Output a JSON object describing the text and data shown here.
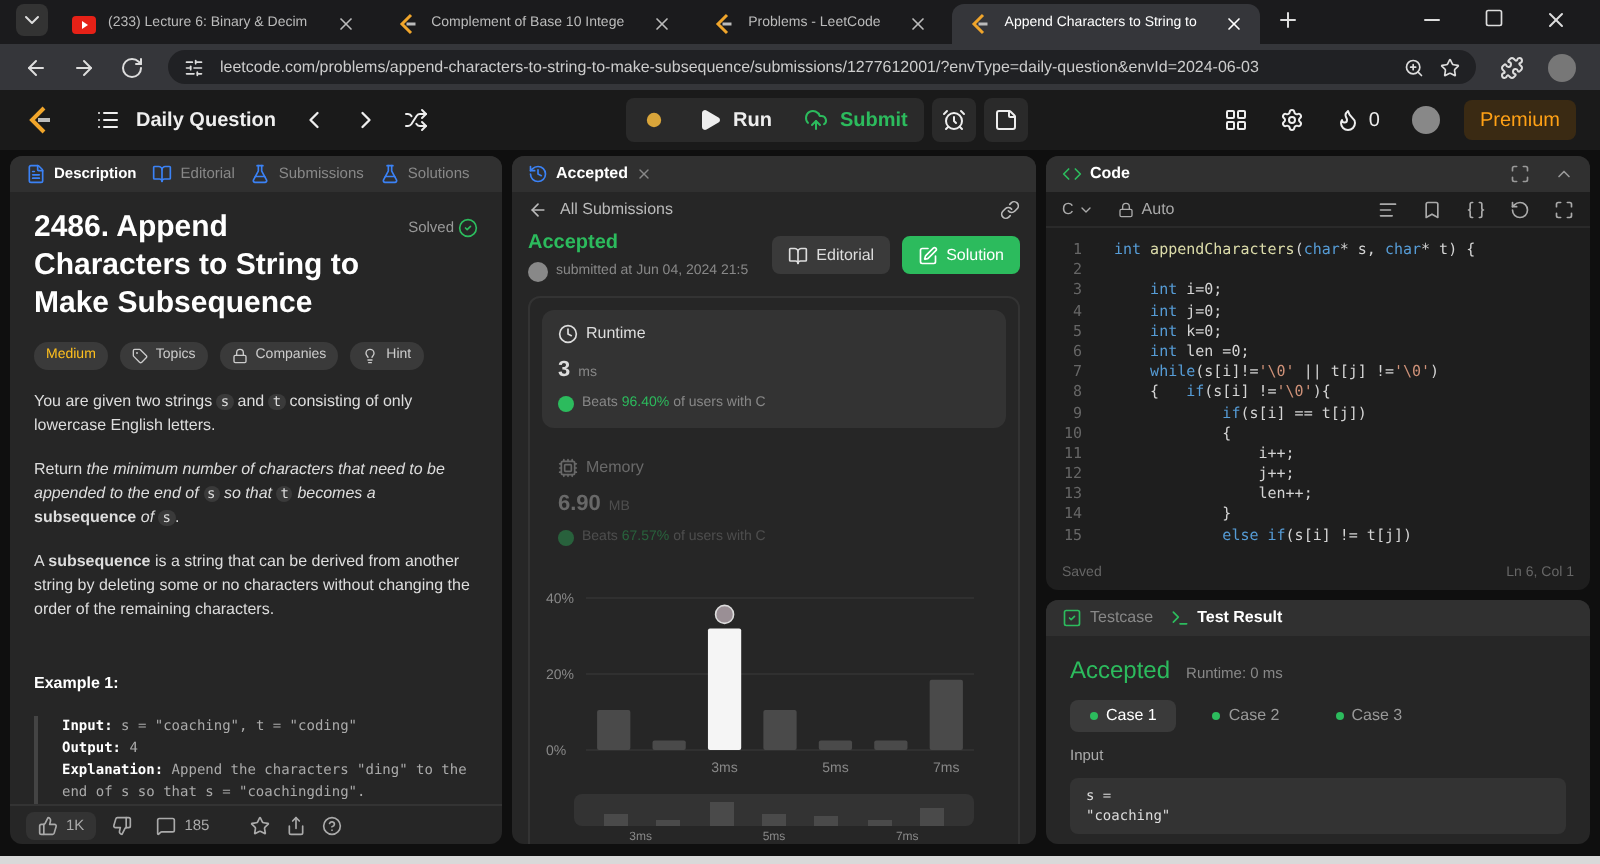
{
  "browser": {
    "tabs": [
      {
        "title": "(233) Lecture 6: Binary & Decim",
        "kind": "video",
        "selected": false
      },
      {
        "title": "Complement of Base 10 Intege",
        "kind": "leetcode",
        "selected": false
      },
      {
        "title": "Problems - LeetCode",
        "kind": "leetcode",
        "selected": false
      },
      {
        "title": "Append Characters to String to",
        "kind": "leetcode",
        "selected": true
      }
    ],
    "url": "leetcode.com/problems/append-characters-to-string-to-make-subsequence/submissions/1277612001/?envType=daily-question&envId=2024-06-03"
  },
  "navbar": {
    "title": "Daily Question",
    "run": "Run",
    "submit": "Submit",
    "streak": "0",
    "premium": "Premium"
  },
  "description_panel": {
    "tabs": [
      {
        "label": "Description",
        "selected": true
      },
      {
        "label": "Editorial",
        "selected": false
      },
      {
        "label": "Submissions",
        "selected": false
      },
      {
        "label": "Solutions",
        "selected": false
      }
    ],
    "title": "2486. Append Characters to String to Make Subsequence",
    "status": "Solved",
    "tags": [
      {
        "label": "Medium",
        "kind": "difficulty"
      },
      {
        "label": "Topics",
        "kind": "topics"
      },
      {
        "label": "Companies",
        "kind": "companies"
      },
      {
        "label": "Hint",
        "kind": "hint"
      }
    ],
    "paragraphs": [
      [
        {
          "kind": "text",
          "t": "You are given two strings "
        },
        {
          "kind": "code",
          "t": "s"
        },
        {
          "kind": "text",
          "t": " and "
        },
        {
          "kind": "code",
          "t": "t"
        },
        {
          "kind": "text",
          "t": " consisting of only lowercase English letters."
        }
      ],
      [
        {
          "kind": "text",
          "t": "Return *the minimum number of characters that need to be appended to the end of* "
        },
        {
          "kind": "code",
          "t": "s"
        },
        {
          "kind": "text",
          "t": " *so that* "
        },
        {
          "kind": "code",
          "t": "t"
        },
        {
          "kind": "text",
          "t": " *becomes a* **subsequence** *of* "
        },
        {
          "kind": "code",
          "t": "s"
        },
        {
          "kind": "text",
          "t": "."
        }
      ],
      [
        {
          "kind": "text",
          "t": "A **subsequence** is a string that can be derived from another string by deleting some or no characters without changing the order of the remaining characters."
        }
      ]
    ],
    "example_title": "Example 1:",
    "example": [
      {
        "label": "Input:",
        "value": "s = \"coaching\", t = \"coding\""
      },
      {
        "label": "Output:",
        "value": "4"
      },
      {
        "label": "Explanation:",
        "value": "Append the characters \"ding\" to the end of s so that s = \"coachingding\"."
      }
    ],
    "likes": "1K",
    "comments": "185"
  },
  "submission_panel": {
    "tab": "Accepted",
    "back": "All Submissions",
    "verdict": "Accepted",
    "submitted": "submitted at Jun 04, 2024 21:5",
    "editorial": "Editorial",
    "solution": "Solution",
    "metrics": [
      {
        "kind": "runtime",
        "label": "Runtime",
        "value": "3",
        "unit": "ms",
        "beats_prefix": "Beats",
        "beats": "96.40%",
        "beats_suffix": "of users with C",
        "selected": true
      },
      {
        "kind": "memory",
        "label": "Memory",
        "value": "6.90",
        "unit": "MB",
        "beats_prefix": "Beats",
        "beats": "67.57%",
        "beats_suffix": "of users with C",
        "selected": false
      }
    ],
    "chart_data": {
      "type": "bar",
      "x": [
        1,
        2,
        3,
        4,
        5,
        6,
        7
      ],
      "xlim": [
        0.5,
        7.5
      ],
      "xticks": [
        {
          "value": 3,
          "label": "3ms"
        },
        {
          "value": 5,
          "label": "5ms"
        },
        {
          "value": 7,
          "label": "7ms"
        }
      ],
      "ylim": [
        0,
        40
      ],
      "yticks": [
        {
          "value": 0,
          "label": "0%"
        },
        {
          "value": 20,
          "label": "20%"
        },
        {
          "value": 40,
          "label": "40%"
        }
      ],
      "series": [
        {
          "color": "#4a4a4a",
          "values": [
            10.5,
            2.5,
            null,
            10.5,
            2.5,
            2.5,
            18.5
          ]
        },
        {
          "color": "#f5f5f5",
          "values": [
            null,
            null,
            32,
            null,
            null,
            null,
            null
          ]
        }
      ]
    },
    "brush_labels": [
      "3ms",
      "5ms",
      "7ms"
    ]
  },
  "code_panel": {
    "title": "Code",
    "language": "C",
    "mode": "Auto",
    "lines": [
      {
        "n": "1",
        "tokens": [
          {
            "kind": "kw",
            "t": "int"
          },
          {
            "kind": "fn",
            "t": " appendCharacters"
          },
          {
            "kind": "p",
            "t": "("
          },
          {
            "kind": "kw",
            "t": "char"
          },
          {
            "kind": "p",
            "t": "* s, "
          },
          {
            "kind": "kw",
            "t": "char"
          },
          {
            "kind": "p",
            "t": "* t) {"
          }
        ]
      },
      {
        "n": "2"
      },
      {
        "n": "3",
        "tokens": [
          {
            "kind": "kw",
            "t": "    int"
          },
          {
            "kind": "p",
            "t": " i=0;"
          }
        ]
      },
      {
        "n": "4",
        "tokens": [
          {
            "kind": "kw",
            "t": "    int"
          },
          {
            "kind": "p",
            "t": " j=0;"
          }
        ]
      },
      {
        "n": "5",
        "tokens": [
          {
            "kind": "kw",
            "t": "    int"
          },
          {
            "kind": "p",
            "t": " k=0;"
          }
        ]
      },
      {
        "n": "6",
        "tokens": [
          {
            "kind": "kw",
            "t": "    int"
          },
          {
            "kind": "p",
            "t": " len =0;"
          }
        ]
      },
      {
        "n": "7",
        "tokens": [
          {
            "kind": "kw",
            "t": "    while"
          },
          {
            "kind": "p",
            "t": "(s[i]!="
          },
          {
            "kind": "str",
            "t": "'\\0'"
          },
          {
            "kind": "p",
            "t": " || t[j] !="
          },
          {
            "kind": "str",
            "t": "'\\0'"
          },
          {
            "kind": "p",
            "t": ")"
          }
        ]
      },
      {
        "n": "8",
        "tokens": [
          {
            "kind": "p",
            "t": "    {   "
          },
          {
            "kind": "kw",
            "t": "if"
          },
          {
            "kind": "p",
            "t": "(s[i] !="
          },
          {
            "kind": "str",
            "t": "'\\0'"
          },
          {
            "kind": "p",
            "t": "){"
          }
        ]
      },
      {
        "n": "9",
        "tokens": [
          {
            "kind": "kw",
            "t": "            if"
          },
          {
            "kind": "p",
            "t": "(s[i] == t[j])"
          }
        ]
      },
      {
        "n": "10",
        "tokens": [
          {
            "kind": "p",
            "t": "            {"
          }
        ]
      },
      {
        "n": "11",
        "tokens": [
          {
            "kind": "p",
            "t": "                i++;"
          }
        ]
      },
      {
        "n": "12",
        "tokens": [
          {
            "kind": "p",
            "t": "                j++;"
          }
        ]
      },
      {
        "n": "13",
        "tokens": [
          {
            "kind": "p",
            "t": "                len++;"
          }
        ]
      },
      {
        "n": "14",
        "tokens": [
          {
            "kind": "p",
            "t": "            }"
          }
        ]
      },
      {
        "n": "15",
        "tokens": [
          {
            "kind": "kw",
            "t": "            else if"
          },
          {
            "kind": "p",
            "t": "(s[i] != t[j])"
          }
        ]
      }
    ],
    "saved": "Saved",
    "cursor": "Ln 6, Col 1"
  },
  "test_panel": {
    "tabs": [
      {
        "label": "Testcase",
        "selected": false
      },
      {
        "label": "Test Result",
        "selected": true
      }
    ],
    "verdict": "Accepted",
    "runtime": "Runtime: 0 ms",
    "cases": [
      {
        "label": "Case 1",
        "selected": true
      },
      {
        "label": "Case 2",
        "selected": false
      },
      {
        "label": "Case 3",
        "selected": false
      }
    ],
    "input_label": "Input",
    "input_lines": [
      "s =",
      "\"coaching\""
    ]
  }
}
